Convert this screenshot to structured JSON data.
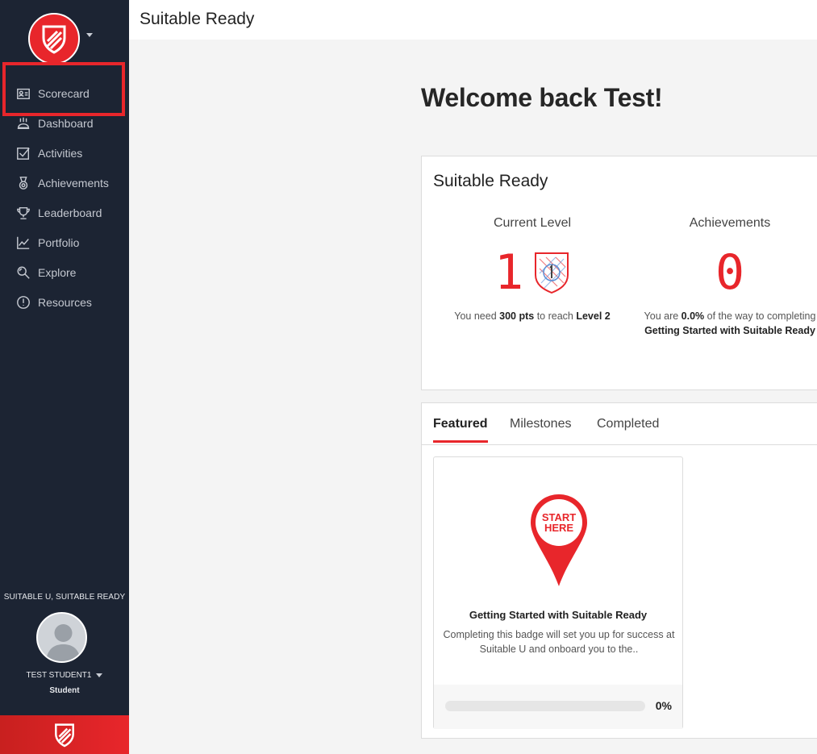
{
  "app": {
    "title": "Suitable Ready"
  },
  "sidebar": {
    "items": [
      {
        "label": "Scorecard",
        "icon": "scorecard-icon"
      },
      {
        "label": "Dashboard",
        "icon": "dashboard-icon"
      },
      {
        "label": "Activities",
        "icon": "checkbox-icon"
      },
      {
        "label": "Achievements",
        "icon": "medal-icon"
      },
      {
        "label": "Leaderboard",
        "icon": "trophy-icon"
      },
      {
        "label": "Portfolio",
        "icon": "chart-icon"
      },
      {
        "label": "Explore",
        "icon": "magnifier-icon"
      },
      {
        "label": "Resources",
        "icon": "info-icon"
      }
    ],
    "org": "SUITABLE U, SUITABLE READY",
    "user": {
      "name": "TEST STUDENT1",
      "role": "Student"
    }
  },
  "main": {
    "welcome": "Welcome back Test!",
    "summary": {
      "title": "Suitable Ready",
      "level": {
        "label": "Current Level",
        "value": "1",
        "note_prefix": "You need ",
        "note_pts": "300 pts",
        "note_mid": " to reach ",
        "note_level": "Level 2"
      },
      "achievements": {
        "label": "Achievements",
        "value": "0",
        "note_prefix": "You are ",
        "note_pct": "0.0%",
        "note_mid": " of the way to completing ",
        "note_target": "Getting Started with Suitable Ready"
      }
    },
    "tabs": [
      {
        "label": "Featured",
        "active": true
      },
      {
        "label": "Milestones",
        "active": false
      },
      {
        "label": "Completed",
        "active": false
      }
    ],
    "badge": {
      "pin_line1": "START",
      "pin_line2": "HERE",
      "title": "Getting Started with Suitable Ready",
      "description": "Completing this badge will set you up for success at Suitable U and onboard you to the..",
      "progress": 0,
      "progress_label": "0%"
    }
  },
  "colors": {
    "accent": "#e8262b",
    "sidebar_bg": "#1c2433"
  }
}
